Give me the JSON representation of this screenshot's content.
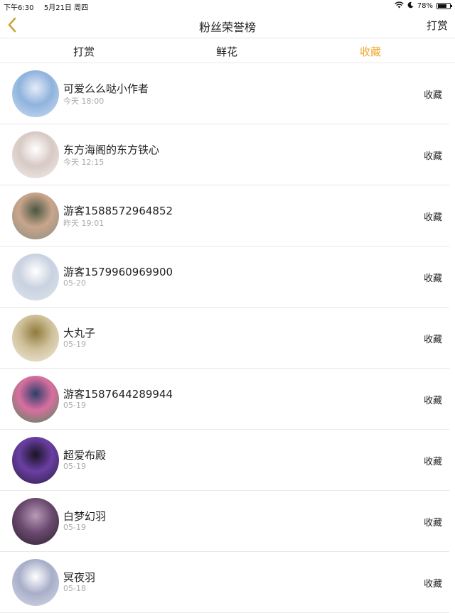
{
  "status_bar": {
    "time": "下午6:30",
    "date": "5月21日 周四",
    "wifi_icon": "wifi-icon",
    "moon_icon": "moon-icon",
    "battery_percent": "78%",
    "battery_level": 0.78
  },
  "nav": {
    "back_icon": "chevron-left-icon",
    "title": "粉丝荣誉榜",
    "right_label": "打赏"
  },
  "tabs": [
    {
      "label": "打赏",
      "active": false
    },
    {
      "label": "鲜花",
      "active": false
    },
    {
      "label": "收藏",
      "active": true
    }
  ],
  "colors": {
    "accent": "#f0a830",
    "divider": "#e8e8e8",
    "secondary_text": "#aaaaaa"
  },
  "items": [
    {
      "name": "可爱么么哒小作者",
      "time": "今天 18:00",
      "action": "收藏",
      "avatar_colors": [
        "#cfe0f4",
        "#8fb3dd",
        "#e6ecf8"
      ]
    },
    {
      "name": "东方海阁的东方铁心",
      "time": "今天 12:15",
      "action": "收藏",
      "avatar_colors": [
        "#f3efed",
        "#d8c9c4",
        "#ffffff"
      ]
    },
    {
      "name": "游客1588572964852",
      "time": "昨天 19:01",
      "action": "收藏",
      "avatar_colors": [
        "#8a8e80",
        "#c9a58d",
        "#4b5740"
      ]
    },
    {
      "name": "游客1579960969900",
      "time": "05-20",
      "action": "收藏",
      "avatar_colors": [
        "#dfe5ef",
        "#c9d2e0",
        "#ffffff"
      ]
    },
    {
      "name": "大丸子",
      "time": "05-19",
      "action": "收藏",
      "avatar_colors": [
        "#f1ece0",
        "#cfc09a",
        "#8f7b3c"
      ]
    },
    {
      "name": "游客1587644289944",
      "time": "05-19",
      "action": "收藏",
      "avatar_colors": [
        "#4a8a55",
        "#d96fa0",
        "#2d3f6b"
      ]
    },
    {
      "name": "超爱布殿",
      "time": "05-19",
      "action": "收藏",
      "avatar_colors": [
        "#2a1e3f",
        "#6a3fa3",
        "#1a1426"
      ]
    },
    {
      "name": "白梦幻羽",
      "time": "05-19",
      "action": "收藏",
      "avatar_colors": [
        "#2b1f30",
        "#6b4a6f",
        "#b89ab8"
      ]
    },
    {
      "name": "冥夜羽",
      "time": "05-18",
      "action": "收藏",
      "avatar_colors": [
        "#d7dbe7",
        "#a8aec9",
        "#ffffff"
      ]
    }
  ]
}
